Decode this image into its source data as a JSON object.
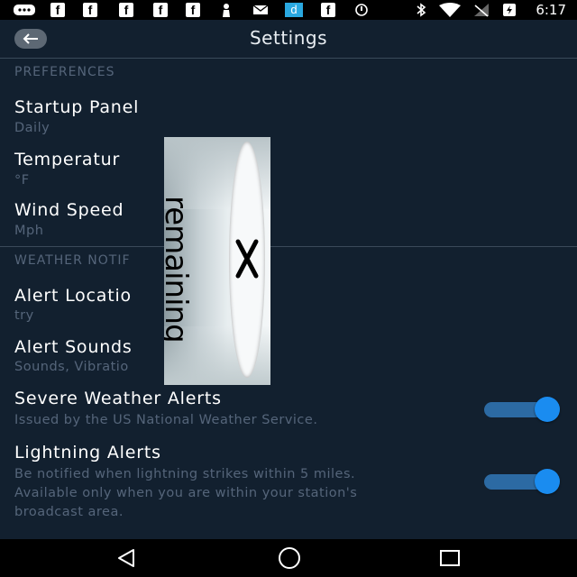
{
  "status_bar": {
    "time": "6:17",
    "icons": [
      "messages-icon",
      "facebook-icon",
      "facebook-icon",
      "facebook-icon",
      "facebook-icon",
      "person-icon",
      "mail-icon",
      "dictionary-icon",
      "facebook-icon",
      "sync-icon",
      "bluetooth-icon",
      "wifi-icon",
      "no-signal-icon",
      "battery-charging-icon"
    ]
  },
  "header": {
    "title": "Settings"
  },
  "preferences": {
    "section_label": "PREFERENCES",
    "items": [
      {
        "title": "Startup Panel",
        "subtitle": "Daily"
      },
      {
        "title": "Temperatur",
        "subtitle": "°F"
      },
      {
        "title": "Wind Speed",
        "subtitle": "Mph"
      }
    ]
  },
  "weather_notifications": {
    "section_label": "WEATHER NOTIF",
    "items": [
      {
        "title": "Alert Locatio",
        "subtitle": "try"
      },
      {
        "title": "Alert Sounds",
        "subtitle": "Sounds, Vibratio"
      },
      {
        "title": "Severe Weather Alerts",
        "subtitle": "Issued by the US National Weather Service.",
        "enabled": true
      },
      {
        "title": "Lightning Alerts",
        "subtitle_lines": [
          "Be notified when lightning strikes within 5 miles.",
          "Available only when you are within your station's",
          "broadcast area."
        ],
        "enabled": true
      }
    ]
  },
  "overlay_ad": {
    "text": "remaining"
  },
  "colors": {
    "background": "#12202f",
    "accent": "#1a8cf0",
    "muted_text": "#55657a"
  }
}
